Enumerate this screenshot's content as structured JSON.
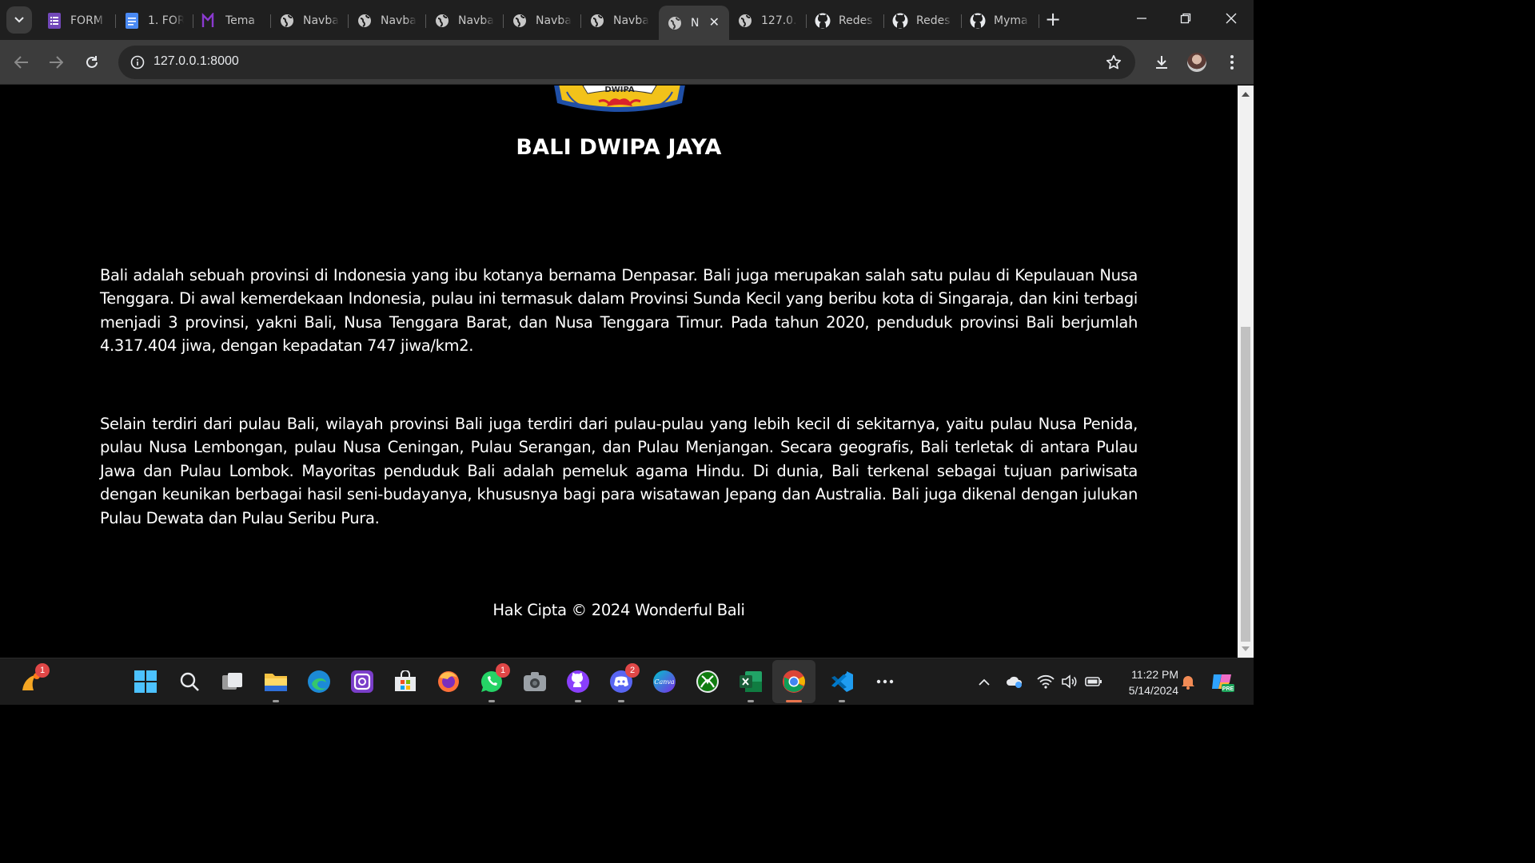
{
  "browser": {
    "tabs": [
      {
        "title": "FORM",
        "icon": "forms-icon",
        "active": false
      },
      {
        "title": "1. FOR",
        "icon": "docs-icon",
        "active": false
      },
      {
        "title": "Tema",
        "icon": "theme-icon",
        "active": false
      },
      {
        "title": "Navba",
        "icon": "globe-icon",
        "active": false
      },
      {
        "title": "Navba",
        "icon": "globe-icon",
        "active": false
      },
      {
        "title": "Navba",
        "icon": "globe-icon",
        "active": false
      },
      {
        "title": "Navba",
        "icon": "globe-icon",
        "active": false
      },
      {
        "title": "Navba",
        "icon": "globe-icon",
        "active": false
      },
      {
        "title": "N",
        "icon": "globe-icon",
        "active": true
      },
      {
        "title": "127.0.",
        "icon": "globe-icon",
        "active": false
      },
      {
        "title": "Redes",
        "icon": "github-icon",
        "active": false
      },
      {
        "title": "Redes",
        "icon": "github-icon",
        "active": false
      },
      {
        "title": "Myma",
        "icon": "github-icon",
        "active": false
      }
    ],
    "url": "127.0.0.1:8000"
  },
  "page": {
    "title": "BALI DWIPA JAYA",
    "logo_text": "DWIPA",
    "paragraphs": [
      "Bali adalah sebuah provinsi di Indonesia yang ibu kotanya bernama Denpasar. Bali juga merupakan salah satu pulau di Kepulauan Nusa Tenggara. Di awal kemerdekaan Indonesia, pulau ini termasuk dalam Provinsi Sunda Kecil yang beribu kota di Singaraja, dan kini terbagi menjadi 3 provinsi, yakni Bali, Nusa Tenggara Barat, dan Nusa Tenggara Timur. Pada tahun 2020, penduduk provinsi Bali berjumlah 4.317.404 jiwa, dengan kepadatan 747 jiwa/km2.",
      "Selain terdiri dari pulau Bali, wilayah provinsi Bali juga terdiri dari pulau-pulau yang lebih kecil di sekitarnya, yaitu pulau Nusa Penida, pulau Nusa Lembongan, pulau Nusa Ceningan, Pulau Serangan, dan Pulau Menjangan. Secara geografis, Bali terletak di antara Pulau Jawa dan Pulau Lombok. Mayoritas penduduk Bali adalah pemeluk agama Hindu. Di dunia, Bali terkenal sebagai tujuan pariwisata dengan keunikan berbagai hasil seni-budayanya, khususnya bagi para wisatawan Jepang dan Australia. Bali juga dikenal dengan julukan Pulau Dewata dan Pulau Seribu Pura."
    ],
    "footer": "Hak Cipta © 2024 Wonderful Bali"
  },
  "taskbar": {
    "widget_badge": "1",
    "whatsapp_badge": "1",
    "discord_badge": "2",
    "canva_label": "Canva",
    "clock_time": "11:22 PM",
    "clock_date": "5/14/2024",
    "copilot_label": "PRE"
  },
  "colors": {
    "tabstrip": "#1f1f1f",
    "toolbar": "#3c3c3c",
    "page_bg": "#000000",
    "taskbar": "#1c1c1c"
  }
}
